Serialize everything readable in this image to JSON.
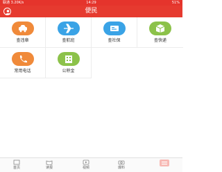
{
  "status_bar": {
    "left": "联通 3.20K/s",
    "time": "14:29",
    "right": "51%"
  },
  "header": {
    "title": "便民",
    "user_icon": "user-icon"
  },
  "services": [
    {
      "label": "查违章",
      "icon": "car-icon",
      "color": "#f08a3a"
    },
    {
      "label": "查航班",
      "icon": "plane-icon",
      "color": "#3aa3e6"
    },
    {
      "label": "查社保",
      "icon": "card-icon",
      "color": "#3aa3e6"
    },
    {
      "label": "查快递",
      "icon": "box-icon",
      "color": "#8cc24a"
    },
    {
      "label": "常用电话",
      "icon": "phone-icon",
      "color": "#f08a3a"
    },
    {
      "label": "公积金",
      "icon": "building-icon",
      "color": "#8cc24a"
    }
  ],
  "tabs": [
    {
      "label": "首页",
      "icon": "home-icon"
    },
    {
      "label": "读报",
      "icon": "book-icon"
    },
    {
      "label": "视频",
      "icon": "video-icon"
    },
    {
      "label": "爆料",
      "icon": "camera-icon"
    },
    {
      "label": "",
      "icon": "more-icon"
    }
  ],
  "colors": {
    "brand": "#e63a2f"
  }
}
